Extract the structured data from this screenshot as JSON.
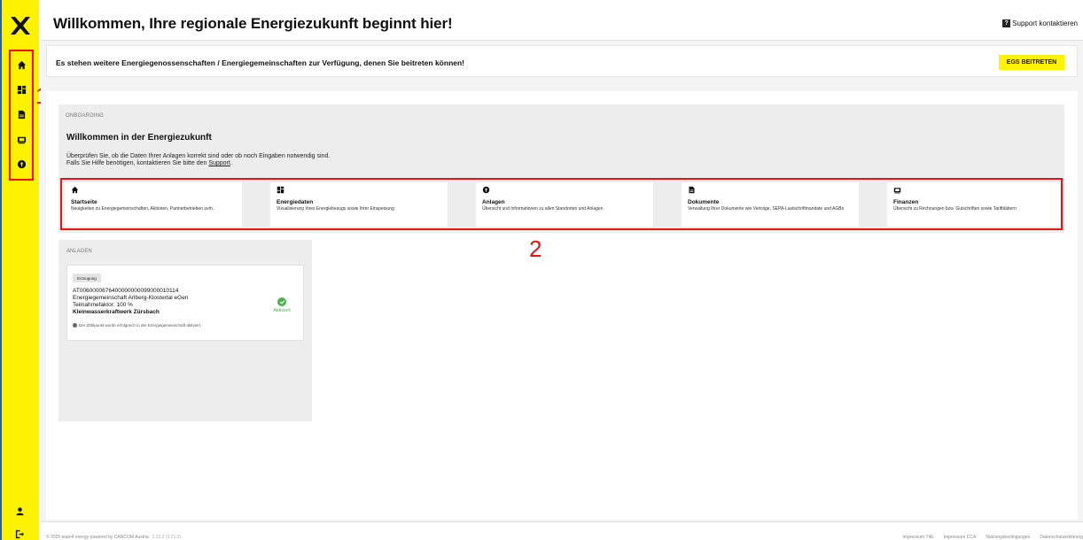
{
  "header": {
    "title": "Willkommen, Ihre regionale Energiezukunft beginnt hier!",
    "support_label": "Support kontaktieren"
  },
  "sidebar": {
    "items": [
      {
        "icon": "home-icon"
      },
      {
        "icon": "dashboard-icon"
      },
      {
        "icon": "document-icon"
      },
      {
        "icon": "wallet-icon"
      },
      {
        "icon": "plant-icon"
      }
    ],
    "bottom": [
      {
        "icon": "user-icon"
      },
      {
        "icon": "logout-icon"
      }
    ]
  },
  "annotations": {
    "label_1": "1",
    "label_2": "2"
  },
  "banner": {
    "text": "Es stehen weitere Energiegenossenschaften / Energiegemeinschaften zur Verfügung, denen Sie beitreten können!",
    "button_label": "EGS BEITRETEN"
  },
  "onboarding": {
    "section_label": "ONBOARDING",
    "title": "Willkommen in der Energiezukunft",
    "text_line1": "Überprüfen Sie, ob die Daten Ihrer Anlagen korrekt sind oder ob noch Eingaben notwendig sind.",
    "text_line2_prefix": "Falls Sie Hilfe benötigen, kontaktieren Sie bitte den ",
    "support_link": "Support",
    "text_line2_suffix": ".",
    "cards": [
      {
        "title": "Startseite",
        "desc": "Neuigkeiten zu Energiegemeinschaften, Aktionen, Partnerbetrieben uvm."
      },
      {
        "title": "Energiedaten",
        "desc": "Visualisierung Ihres Energiebezugs sowie Ihrer Einspeisung"
      },
      {
        "title": "Anlagen",
        "desc": "Übersicht und Informationen zu allen Standorten und Anlagen"
      },
      {
        "title": "Dokumente",
        "desc": "Verwaltung Ihrer Dokumente wie Verträge, SEPA-Lastschriftmandate und AGBs"
      },
      {
        "title": "Finanzen",
        "desc": "Übersicht zu Rechnungen bzw. Gutschriften sowie Tarifblättern"
      }
    ]
  },
  "anlagen": {
    "section_label": "ANLAGEN",
    "card": {
      "tag": "Erzeugung",
      "id": "AT0060000676400000000099000010114",
      "community": "Energiegemeinschaft Arlberg-Klostertal eGen",
      "factor": "Teilnahmefaktor: 100 %",
      "name": "Kleinwasserkraftwerk Zürsbach",
      "note": "Der Zählpunkt wurde erfolgreich in der Energiegemeinschaft aktiviert.",
      "status": "Aktiviert",
      "status_color": "#4caf50"
    }
  },
  "footer": {
    "copyright": "© 2025 team4 energy powered by CANCOM Austria",
    "version": "2.21.2 (2.21.2)",
    "links": [
      "Impressum T4E",
      "Impressum CCA",
      "Nutzungsbedingungen",
      "Datenschutzerklärung"
    ]
  },
  "colors": {
    "brand_yellow": "#fff200",
    "annotation_red": "#e11111"
  }
}
